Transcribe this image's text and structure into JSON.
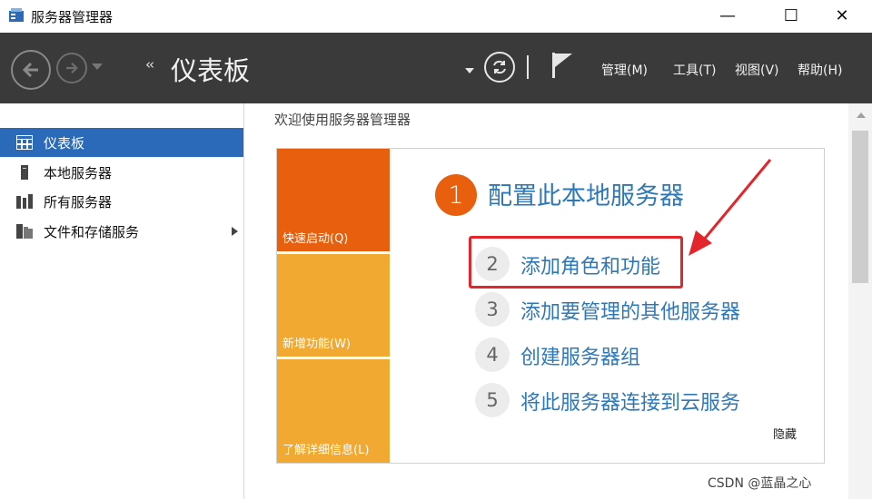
{
  "window": {
    "title": "服务器管理器",
    "minimize_glyph": "—",
    "maximize_glyph": "☐",
    "close_glyph": "✕"
  },
  "header": {
    "breadcrumb_arrows": "‹‹",
    "page_title": "仪表板",
    "menu": {
      "manage": "管理(M)",
      "tools": "工具(T)",
      "view": "视图(V)",
      "help": "帮助(H)"
    }
  },
  "sidebar": {
    "items": [
      {
        "label": "仪表板",
        "icon": "dashboard-icon",
        "active": true
      },
      {
        "label": "本地服务器",
        "icon": "local-server-icon",
        "active": false
      },
      {
        "label": "所有服务器",
        "icon": "all-servers-icon",
        "active": false
      },
      {
        "label": "文件和存储服务",
        "icon": "file-storage-icon",
        "active": false
      }
    ]
  },
  "main": {
    "welcome": "欢迎使用服务器管理器",
    "tiles": {
      "quick_start": "快速启动(Q)",
      "whats_new": "新增功能(W)",
      "learn_more": "了解详细信息(L)"
    },
    "step1": {
      "number": "1",
      "label": "配置此本地服务器"
    },
    "steps": [
      {
        "number": "2",
        "label": "添加角色和功能"
      },
      {
        "number": "3",
        "label": "添加要管理的其他服务器"
      },
      {
        "number": "4",
        "label": "创建服务器组"
      },
      {
        "number": "5",
        "label": "将此服务器连接到云服务"
      }
    ],
    "hide": "隐藏"
  },
  "watermark": "CSDN @蓝晶之心",
  "colors": {
    "header_bg": "#3a3a3a",
    "active_blue": "#2a6ab8",
    "orange": "#e8600e",
    "amber": "#f1a932",
    "link_blue": "#2e78b8",
    "annotation_red": "#e3262b"
  }
}
